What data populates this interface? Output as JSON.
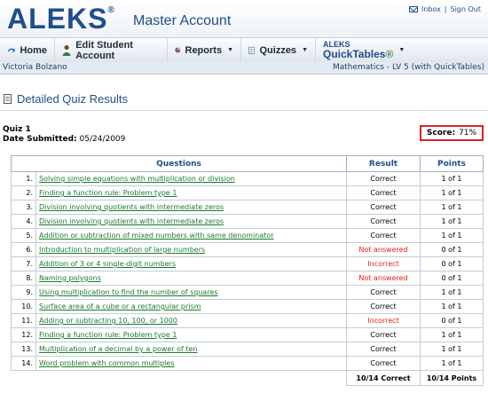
{
  "header": {
    "logo": "ALEKS",
    "logo_mark": "®",
    "account_title": "Master Account",
    "inbox": "Inbox",
    "sign_out": "Sign Out",
    "separator": "|"
  },
  "nav": {
    "home": "Home",
    "edit_student": "Edit Student Account",
    "reports": "Reports",
    "quizzes": "Quizzes",
    "quicktables_top": "ALEKS",
    "quicktables_label": "QuickTables",
    "quicktables_mark": "®",
    "caret": "▼"
  },
  "info": {
    "student": "Victoria Bolzano",
    "course": "Mathematics - LV 5 (with QuickTables)"
  },
  "page": {
    "title": "Detailed Quiz Results",
    "quiz_name": "Quiz 1",
    "date_label": "Date Submitted:",
    "date_value": "05/24/2009",
    "score_label": "Score:",
    "score_value": "71%"
  },
  "table": {
    "headers": [
      "Questions",
      "Result",
      "Points"
    ],
    "rows": [
      {
        "num": "1.",
        "question": "Solving simple equations with multiplication or division",
        "result": "Correct",
        "points": "1 of 1"
      },
      {
        "num": "2.",
        "question": "Finding a function rule: Problem type 1",
        "result": "Correct",
        "points": "1 of 1"
      },
      {
        "num": "3.",
        "question": "Division involving quotients with intermediate zeros",
        "result": "Correct",
        "points": "1 of 1"
      },
      {
        "num": "4.",
        "question": "Division involving quotients with intermediate zeros",
        "result": "Correct",
        "points": "1 of 1"
      },
      {
        "num": "5.",
        "question": "Addition or subtraction of mixed numbers with same denominator",
        "result": "Correct",
        "points": "1 of 1"
      },
      {
        "num": "6.",
        "question": "Introduction to multiplication of large numbers",
        "result": "Not answered",
        "points": "0 of 1"
      },
      {
        "num": "7.",
        "question": "Addition of 3 or 4 single-digit numbers",
        "result": "Incorrect",
        "points": "0 of 1"
      },
      {
        "num": "8.",
        "question": "Naming polygons",
        "result": "Not answered",
        "points": "0 of 1"
      },
      {
        "num": "9.",
        "question": "Using multiplication to find the number of squares",
        "result": "Correct",
        "points": "1 of 1"
      },
      {
        "num": "10.",
        "question": "Surface area of a cube or a rectangular prism",
        "result": "Correct",
        "points": "1 of 1"
      },
      {
        "num": "11.",
        "question": "Adding or subtracting 10, 100, or 1000",
        "result": "Incorrect",
        "points": "0 of 1"
      },
      {
        "num": "12.",
        "question": "Finding a function rule: Problem type 1",
        "result": "Correct",
        "points": "1 of 1"
      },
      {
        "num": "13.",
        "question": "Multiplication of a decimal by a power of ten",
        "result": "Correct",
        "points": "1 of 1"
      },
      {
        "num": "14.",
        "question": "Word problem with common multiples",
        "result": "Correct",
        "points": "1 of 1"
      }
    ],
    "total_result": "10/14 Correct",
    "total_points": "10/14 Points"
  },
  "colors": {
    "brand": "#1f4e8c",
    "link": "#1c7a2e",
    "error": "#e01b1b",
    "score_border": "#dd2222"
  }
}
